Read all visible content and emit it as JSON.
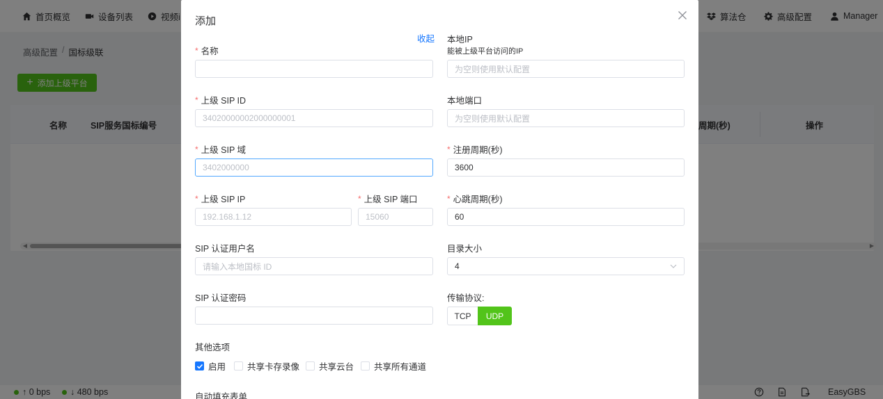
{
  "nav": {
    "items": [
      {
        "label": "首页概览",
        "icon": "home-icon"
      },
      {
        "label": "设备列表",
        "icon": "video-camera-icon"
      },
      {
        "label": "视频i",
        "icon": "play-circle-icon"
      },
      {
        "label": "算法仓",
        "icon": "dropbox-icon"
      },
      {
        "label": "高级配置",
        "icon": "gear-icon"
      },
      {
        "label": "Manager",
        "icon": "user-icon"
      }
    ]
  },
  "breadcrumb": {
    "parent": "高级配置",
    "separator": "/",
    "current": "国标级联"
  },
  "page": {
    "add_button_label": "添加上级平台"
  },
  "table": {
    "columns": [
      "名称",
      "SIP服务国标编号",
      "周期(秒)",
      "操作"
    ]
  },
  "footer": {
    "upload": "↑ 0 bps",
    "download": "↓ 480 bps",
    "brand": "EasyGBS"
  },
  "dialog": {
    "title": "添加",
    "collapse_link": "收起",
    "left": {
      "name": {
        "label": "名称",
        "value": ""
      },
      "sip_id": {
        "label": "上级 SIP ID",
        "placeholder": "34020000002000000001"
      },
      "sip_domain": {
        "label": "上级 SIP 域",
        "placeholder": "3402000000"
      },
      "sip_ip": {
        "label": "上级 SIP IP",
        "placeholder": "192.168.1.12"
      },
      "sip_port": {
        "label": "上级 SIP 端口",
        "placeholder": "15060"
      },
      "auth_user": {
        "label": "SIP 认证用户名",
        "placeholder": "请输入本地国标 ID"
      },
      "auth_pass": {
        "label": "SIP 认证密码",
        "value": ""
      }
    },
    "right": {
      "local_ip": {
        "label": "本地IP",
        "hint": "能被上级平台访问的IP",
        "placeholder": "为空则使用默认配置"
      },
      "local_port": {
        "label": "本地端口",
        "placeholder": "为空则使用默认配置"
      },
      "register_period": {
        "label": "注册周期(秒)",
        "value": "3600"
      },
      "heartbeat_period": {
        "label": "心跳周期(秒)",
        "value": "60"
      },
      "catalog_size": {
        "label": "目录大小",
        "value": "4"
      },
      "transport": {
        "label": "传输协议:",
        "options": [
          "TCP",
          "UDP"
        ],
        "selected": "UDP"
      }
    },
    "other_options": {
      "label": "其他选项",
      "items": [
        {
          "label": "启用",
          "checked": true
        },
        {
          "label": "共享卡存录像",
          "checked": false
        },
        {
          "label": "共享云台",
          "checked": false
        },
        {
          "label": "共享所有通道",
          "checked": false
        }
      ]
    },
    "autofill_label": "自动填充表单"
  },
  "colors": {
    "primary_green": "#52c41a",
    "link_blue": "#1677ff",
    "required_red": "#f56c6c"
  }
}
